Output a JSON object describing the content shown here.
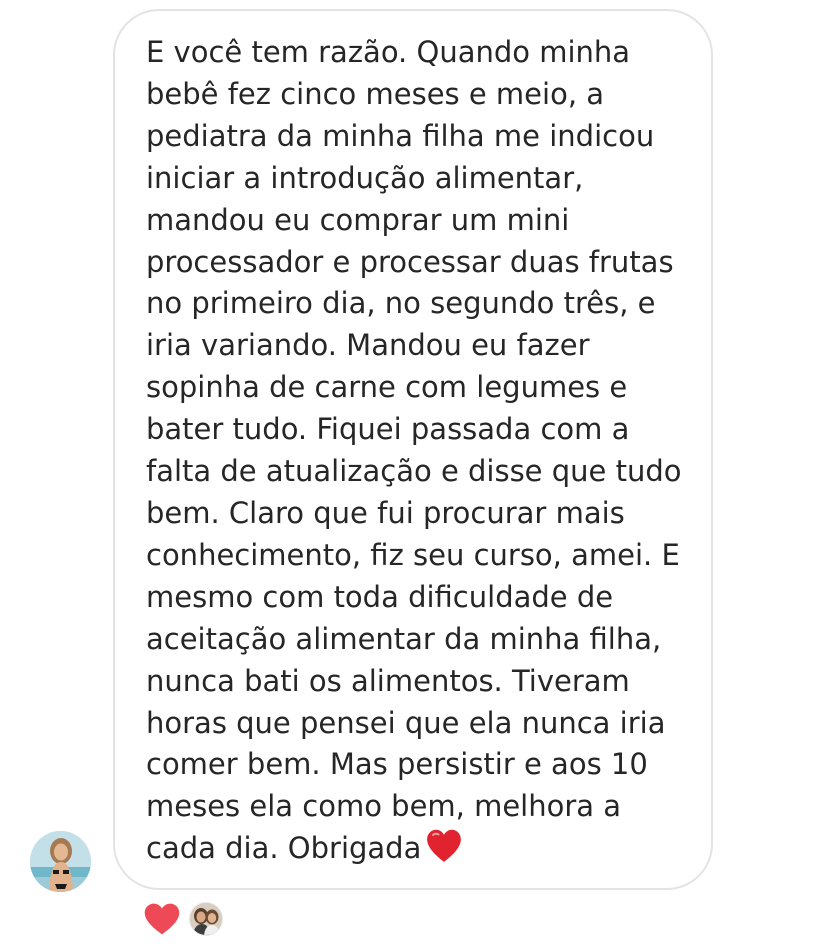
{
  "message": {
    "lines": [
      "E você tem razão. Quando minha",
      "bebê fez cinco meses e meio, a",
      "pediatra da minha filha me indicou",
      "iniciar a introdução alimentar,",
      "mandou eu comprar um mini",
      "processador e processar duas frutas",
      "no primeiro dia, no segundo três, e",
      "iria variando. Mandou eu fazer",
      "sopinha de carne com legumes e",
      "bater tudo. Fiquei passada com a",
      "falta de atualização e disse que tudo",
      "bem. Claro que fui procurar mais",
      "conhecimento, fiz seu curso, amei. E",
      "mesmo com toda dificuldade de",
      "aceitação alimentar da minha filha,",
      "nunca bati os alimentos. Tiveram",
      "horas que pensei que ela nunca iria",
      "comer bem. Mas persistir e aos 10",
      "meses ela como bem, melhora a",
      "cada dia. Obrigada"
    ],
    "trailing_emoji": "red-heart-emoji"
  },
  "sender": {
    "avatar_icon": "sender-avatar-photo"
  },
  "reaction": {
    "icon": "red-heart-icon",
    "reactor_avatar_icon": "reactor-avatar-photo"
  },
  "colors": {
    "text": "#262626",
    "bubble_border": "#e3e3e3",
    "heart": "#ed4956"
  }
}
